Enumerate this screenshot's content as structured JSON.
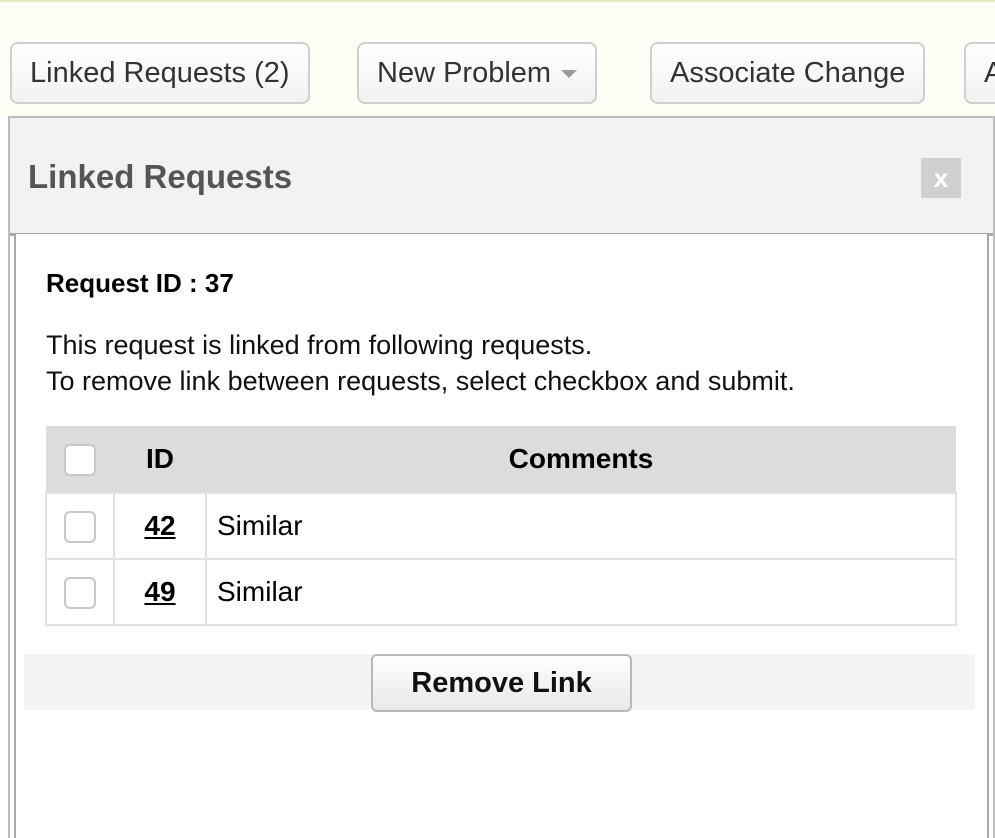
{
  "toolbar": {
    "buttons": [
      {
        "label": "Linked Requests (2)"
      },
      {
        "label": "New Problem"
      },
      {
        "label": "Associate Change"
      },
      {
        "label": "A"
      }
    ]
  },
  "dialog": {
    "title": "Linked Requests",
    "close_label": "x",
    "request_id": "Request ID : 37",
    "description_line1": "This request is linked from following requests.",
    "description_line2": "To remove link between requests, select checkbox and submit.",
    "table": {
      "headers": {
        "id": "ID",
        "comments": "Comments"
      },
      "rows": [
        {
          "id": "42",
          "comment": "Similar"
        },
        {
          "id": "49",
          "comment": "Similar"
        }
      ]
    },
    "remove_button": "Remove Link"
  }
}
